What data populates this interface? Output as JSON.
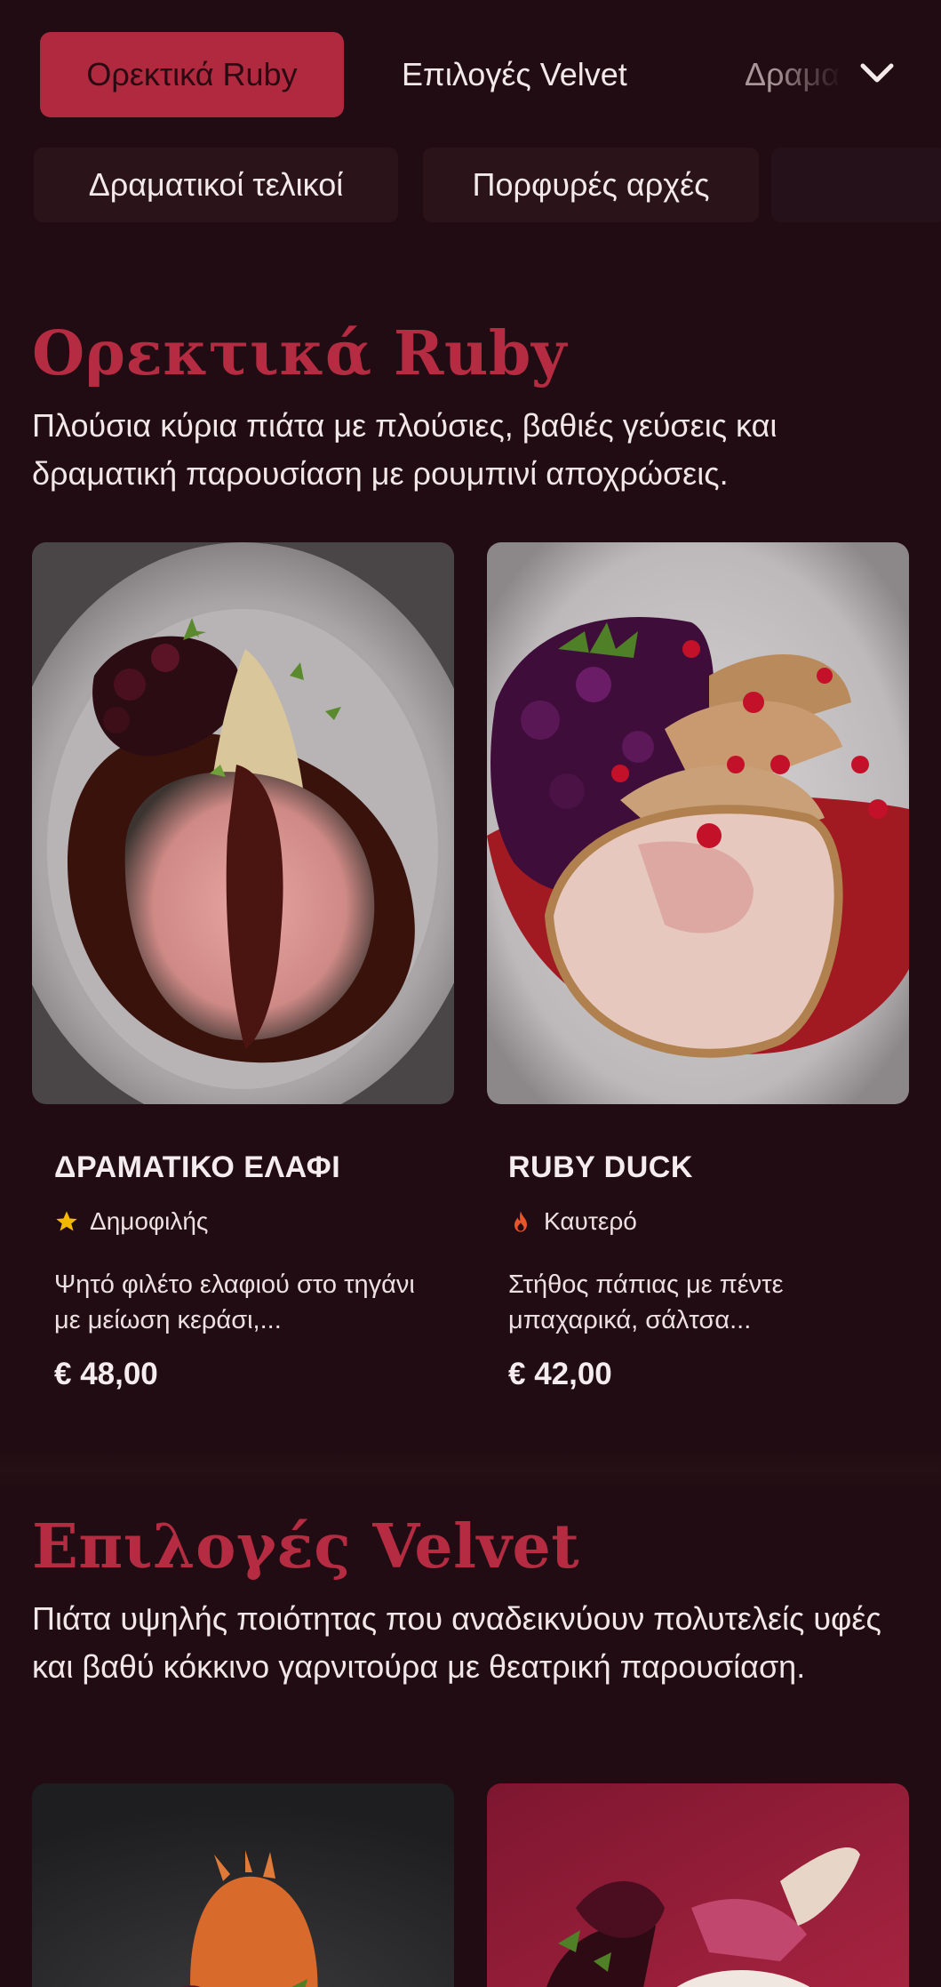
{
  "nav": {
    "tabs": [
      {
        "label": "Ορεκτικά Ruby",
        "active": true
      },
      {
        "label": "Επιλογές Velvet",
        "active": false
      },
      {
        "label": "Δραματικοί",
        "active": false
      }
    ],
    "pills": [
      "Δραματικοί τελικοί",
      "Πορφυρές αρχές"
    ]
  },
  "sections": [
    {
      "title": "Ορεκτικά Ruby",
      "description": "Πλούσια κύρια πιάτα με πλούσιες, βαθιές γεύσεις και δραματική παρουσίαση με ρουμπινί αποχρώσεις.",
      "dishes": [
        {
          "name": "ΔΡΑΜΑΤΙΚΟ ΕΛΑΦΙ",
          "badge": "Δημοφιλής",
          "badge_icon": "star-icon",
          "description": "Ψητό φιλέτο ελαφιού στο τηγάνι με μείωση κεράσι,...",
          "price": "€ 48,00"
        },
        {
          "name": "RUBY DUCK",
          "badge": "Καυτερό",
          "badge_icon": "flame-icon",
          "description": "Στήθος πάπιας με πέντε μπαχαρικά, σάλτσα...",
          "price": "€ 42,00"
        }
      ]
    },
    {
      "title": "Επιλογές Velvet",
      "description": "Πιάτα υψηλής ποιότητας που αναδεικνύουν πολυτελείς υφές και βαθύ κόκκινο γαρνιτούρα με θεατρική παρουσίαση."
    }
  ],
  "colors": {
    "background": "#200c12",
    "accent": "#b52b41",
    "active_tab": "#b0293e",
    "star": "#f5b800",
    "flame": "#e8552a"
  }
}
